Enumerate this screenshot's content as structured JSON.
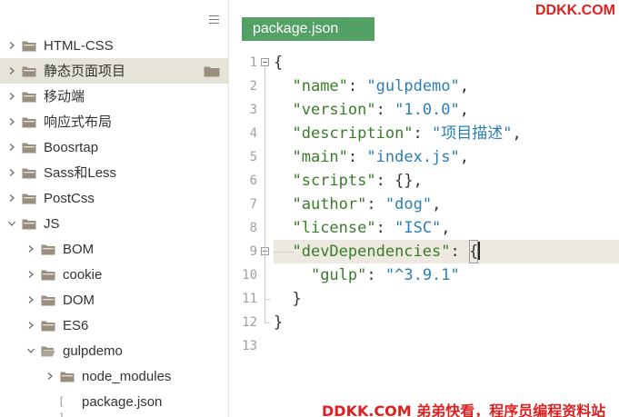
{
  "sidebar": {
    "menu_icon": "hamburger-menu-icon",
    "items": [
      {
        "label": "HTML-CSS",
        "kind": "folder",
        "level": 0,
        "expanded": false
      },
      {
        "label": "静态页面项目",
        "kind": "folder",
        "level": 0,
        "expanded": false,
        "selected": true
      },
      {
        "label": "移动端",
        "kind": "folder",
        "level": 0,
        "expanded": false
      },
      {
        "label": "响应式布局",
        "kind": "folder",
        "level": 0,
        "expanded": false
      },
      {
        "label": "Boosrtap",
        "kind": "folder",
        "level": 0,
        "expanded": false
      },
      {
        "label": "Sass和Less",
        "kind": "folder",
        "level": 0,
        "expanded": false
      },
      {
        "label": "PostCss",
        "kind": "folder",
        "level": 0,
        "expanded": false
      },
      {
        "label": "JS",
        "kind": "folder",
        "level": 0,
        "expanded": true
      },
      {
        "label": "BOM",
        "kind": "folder",
        "level": 1,
        "expanded": false
      },
      {
        "label": "cookie",
        "kind": "folder",
        "level": 1,
        "expanded": false
      },
      {
        "label": "DOM",
        "kind": "folder",
        "level": 1,
        "expanded": false
      },
      {
        "label": "ES6",
        "kind": "folder",
        "level": 1,
        "expanded": false
      },
      {
        "label": "gulpdemo",
        "kind": "folder",
        "level": 1,
        "expanded": true,
        "open": true
      },
      {
        "label": "node_modules",
        "kind": "folder",
        "level": 2,
        "expanded": false
      },
      {
        "label": "package.json",
        "kind": "file",
        "level": 2
      }
    ]
  },
  "editor": {
    "tab_label": "package.json",
    "current_line": 9,
    "lines": [
      {
        "num": "1",
        "text": "{"
      },
      {
        "num": "2",
        "text": "  \"name\": \"gulpdemo\","
      },
      {
        "num": "3",
        "text": "  \"version\": \"1.0.0\","
      },
      {
        "num": "4",
        "text": "  \"description\": \"项目描述\","
      },
      {
        "num": "5",
        "text": "  \"main\": \"index.js\","
      },
      {
        "num": "6",
        "text": "  \"scripts\": {},"
      },
      {
        "num": "7",
        "text": "  \"author\": \"dog\","
      },
      {
        "num": "8",
        "text": "  \"license\": \"ISC\","
      },
      {
        "num": "9",
        "text": "  \"devDependencies\": {"
      },
      {
        "num": "10",
        "text": "    \"gulp\": \"^3.9.1\""
      },
      {
        "num": "11",
        "text": "  }"
      },
      {
        "num": "12",
        "text": "}"
      },
      {
        "num": "13",
        "text": ""
      }
    ]
  },
  "watermarks": {
    "top": "DDKK.COM",
    "bottom": "DDKK.COM 弟弟快看，程序员编程资料站"
  },
  "colors": {
    "tab_bg": "#53a165",
    "selected_row": "#e6e4d8",
    "current_line": "#ede9e0",
    "key": "#3a7c2a",
    "string": "#2b7fb5",
    "watermark": "#e02020",
    "folder": "#9a8f7e"
  }
}
